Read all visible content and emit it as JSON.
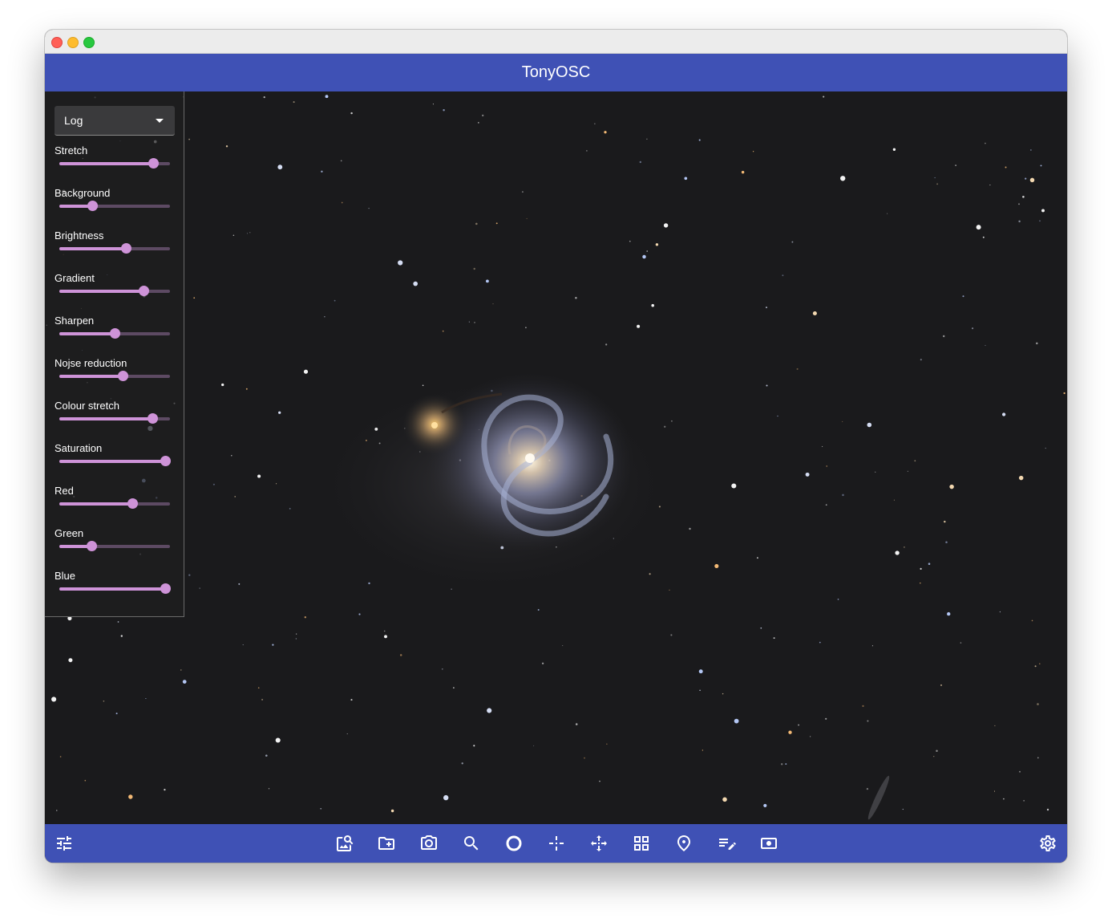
{
  "app": {
    "title": "TonyOSC"
  },
  "stretch_mode": {
    "selected": "Log"
  },
  "sliders": [
    {
      "label": "Stretch",
      "value": 0.85
    },
    {
      "label": "Background",
      "value": 0.3
    },
    {
      "label": "Brightness",
      "value": 0.6
    },
    {
      "label": "Gradient",
      "value": 0.76
    },
    {
      "label": "Sharpen",
      "value": 0.5
    },
    {
      "label": "Nojse reduction",
      "value": 0.57
    },
    {
      "label": "Colour stretch",
      "value": 0.84
    },
    {
      "label": "Saturation",
      "value": 0.96
    },
    {
      "label": "Red",
      "value": 0.66
    },
    {
      "label": "Green",
      "value": 0.29
    },
    {
      "label": "Blue",
      "value": 0.96
    }
  ],
  "toolbar": {
    "left": "tune-icon",
    "center": [
      "image-search-icon",
      "folder-add-icon",
      "camera-icon",
      "search-icon",
      "circle-icon",
      "crosshair-icon",
      "align-icon",
      "grid-icon",
      "location-pin-icon",
      "list-edit-icon",
      "screenshot-icon"
    ],
    "right": "settings-gear-icon"
  },
  "colors": {
    "accent": "#3f51b5",
    "slider": "#ce93d8",
    "background": "#1a1a1c"
  }
}
